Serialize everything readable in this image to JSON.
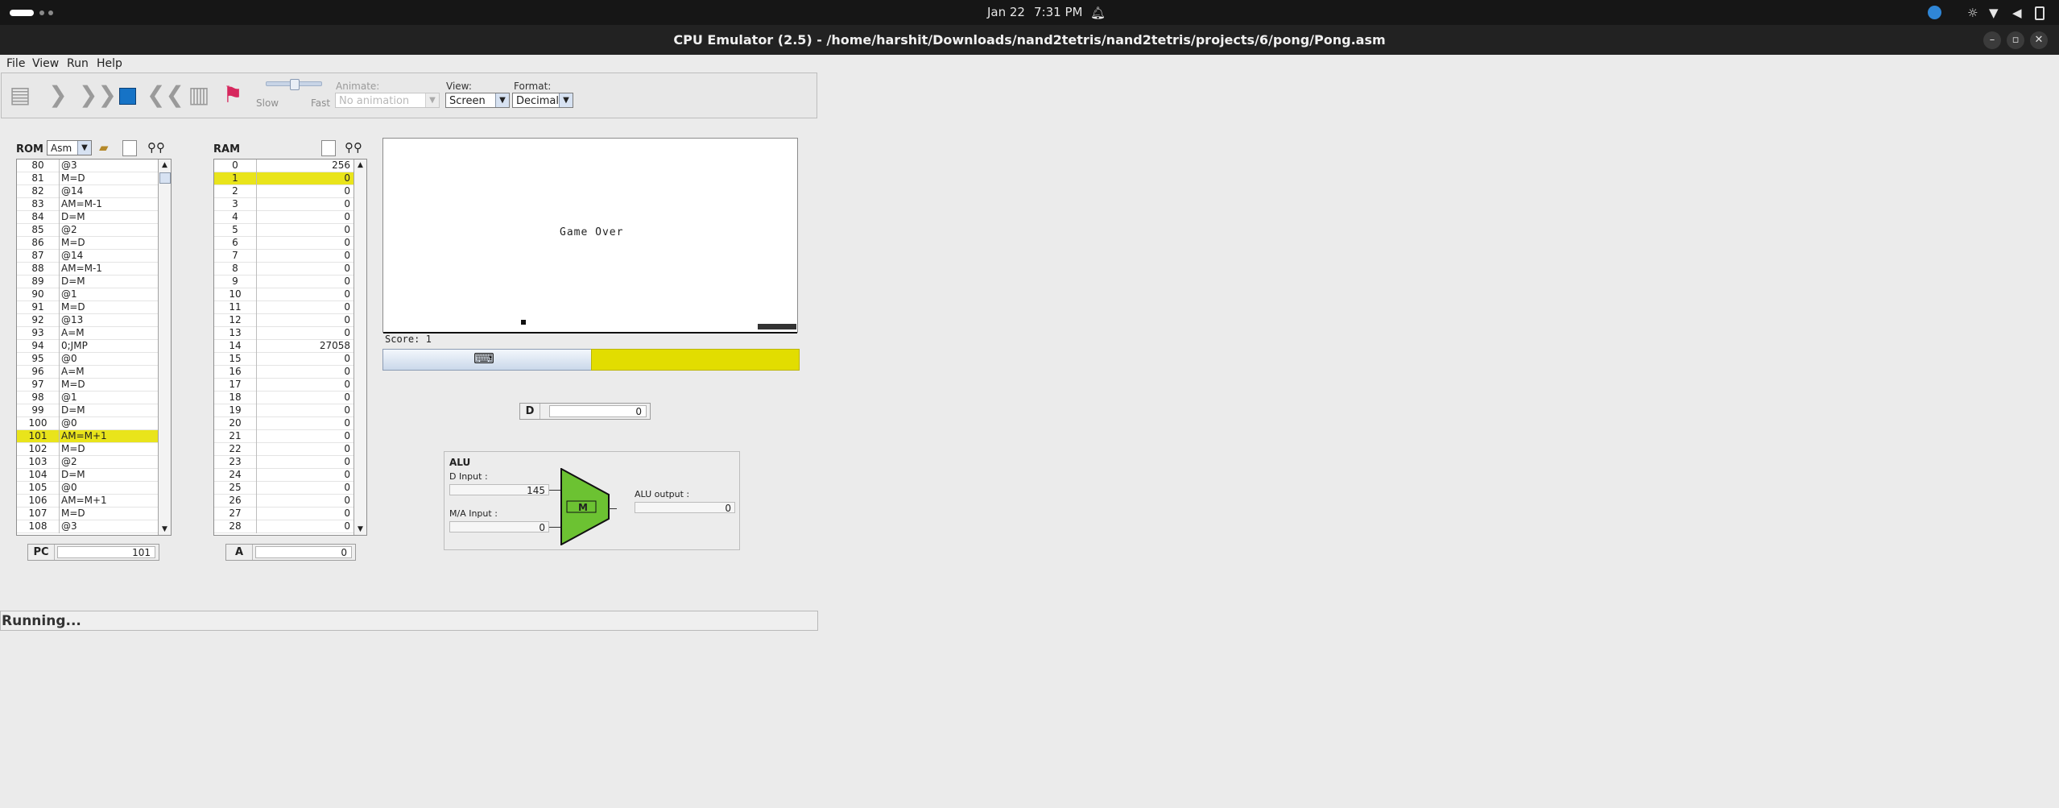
{
  "system_bar": {
    "date": "Jan 22",
    "time": "7:31 PM"
  },
  "window": {
    "title": "CPU Emulator (2.5) - /home/harshit/Downloads/nand2tetris/nand2tetris/projects/6/pong/Pong.asm"
  },
  "menu": [
    "File",
    "View",
    "Run",
    "Help"
  ],
  "toolbar": {
    "speed_slow": "Slow",
    "speed_fast": "Fast",
    "speed_level": 0.5,
    "animate_label": "Animate:",
    "animate_value": "No animation",
    "view_label": "View:",
    "view_value": "Screen",
    "format_label": "Format:",
    "format_value": "Decimal"
  },
  "rom": {
    "title": "ROM",
    "mode": "Asm",
    "rows": [
      {
        "i": "80",
        "v": "@3"
      },
      {
        "i": "81",
        "v": "M=D"
      },
      {
        "i": "82",
        "v": "@14"
      },
      {
        "i": "83",
        "v": "AM=M-1"
      },
      {
        "i": "84",
        "v": "D=M"
      },
      {
        "i": "85",
        "v": "@2"
      },
      {
        "i": "86",
        "v": "M=D"
      },
      {
        "i": "87",
        "v": "@14"
      },
      {
        "i": "88",
        "v": "AM=M-1"
      },
      {
        "i": "89",
        "v": "D=M"
      },
      {
        "i": "90",
        "v": "@1"
      },
      {
        "i": "91",
        "v": "M=D"
      },
      {
        "i": "92",
        "v": "@13"
      },
      {
        "i": "93",
        "v": "A=M"
      },
      {
        "i": "94",
        "v": "0;JMP"
      },
      {
        "i": "95",
        "v": "@0"
      },
      {
        "i": "96",
        "v": "A=M"
      },
      {
        "i": "97",
        "v": "M=D"
      },
      {
        "i": "98",
        "v": "@1"
      },
      {
        "i": "99",
        "v": "D=M"
      },
      {
        "i": "100",
        "v": "@0"
      },
      {
        "i": "101",
        "v": "AM=M+1"
      },
      {
        "i": "102",
        "v": "M=D"
      },
      {
        "i": "103",
        "v": "@2"
      },
      {
        "i": "104",
        "v": "D=M"
      },
      {
        "i": "105",
        "v": "@0"
      },
      {
        "i": "106",
        "v": "AM=M+1"
      },
      {
        "i": "107",
        "v": "M=D"
      },
      {
        "i": "108",
        "v": "@3"
      }
    ],
    "highlight": "101"
  },
  "ram": {
    "title": "RAM",
    "rows": [
      {
        "i": "0",
        "v": "256"
      },
      {
        "i": "1",
        "v": "0"
      },
      {
        "i": "2",
        "v": "0"
      },
      {
        "i": "3",
        "v": "0"
      },
      {
        "i": "4",
        "v": "0"
      },
      {
        "i": "5",
        "v": "0"
      },
      {
        "i": "6",
        "v": "0"
      },
      {
        "i": "7",
        "v": "0"
      },
      {
        "i": "8",
        "v": "0"
      },
      {
        "i": "9",
        "v": "0"
      },
      {
        "i": "10",
        "v": "0"
      },
      {
        "i": "11",
        "v": "0"
      },
      {
        "i": "12",
        "v": "0"
      },
      {
        "i": "13",
        "v": "0"
      },
      {
        "i": "14",
        "v": "27058"
      },
      {
        "i": "15",
        "v": "0"
      },
      {
        "i": "16",
        "v": "0"
      },
      {
        "i": "17",
        "v": "0"
      },
      {
        "i": "18",
        "v": "0"
      },
      {
        "i": "19",
        "v": "0"
      },
      {
        "i": "20",
        "v": "0"
      },
      {
        "i": "21",
        "v": "0"
      },
      {
        "i": "22",
        "v": "0"
      },
      {
        "i": "23",
        "v": "0"
      },
      {
        "i": "24",
        "v": "0"
      },
      {
        "i": "25",
        "v": "0"
      },
      {
        "i": "26",
        "v": "0"
      },
      {
        "i": "27",
        "v": "0"
      },
      {
        "i": "28",
        "v": "0"
      }
    ],
    "highlight": "1"
  },
  "registers": {
    "pc_label": "PC",
    "pc": "101",
    "a_label": "A",
    "a": "0",
    "d_label": "D",
    "d": "0"
  },
  "screen": {
    "game_over": "Game Over",
    "score": "Score: 1"
  },
  "alu": {
    "title": "ALU",
    "d_input_label": "D Input :",
    "d_input": "145",
    "ma_input_label": "M/A Input :",
    "ma_input": "0",
    "output_label": "ALU output :",
    "output": "0",
    "op": "M",
    "color": "#6cc232"
  },
  "status": {
    "text": "Running..."
  },
  "colors": {
    "highlight": "#e9e41b",
    "keyboard_bar": "#e2dd00"
  }
}
